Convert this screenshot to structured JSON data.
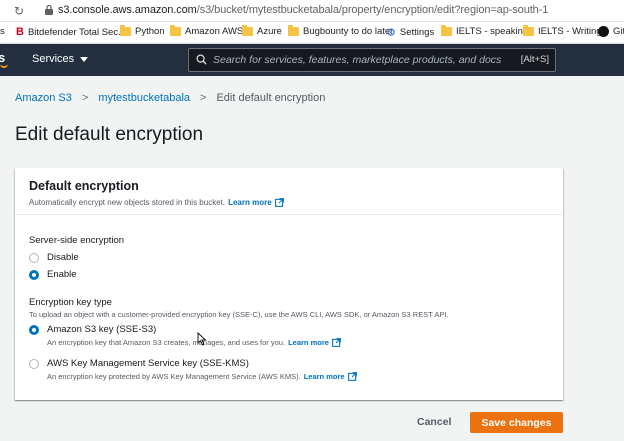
{
  "browser": {
    "url_host": "s3.console.aws.amazon.com",
    "url_path": "/s3/bucket/mytestbucketabala/property/encryption/edit?region=ap-south-1",
    "bookmarks": [
      {
        "label": "s",
        "icon": "none"
      },
      {
        "label": "Bitdefender Total Sec...",
        "icon": "bitdefender-icon"
      },
      {
        "label": "Python",
        "icon": "folder-icon"
      },
      {
        "label": "Amazon AWS",
        "icon": "folder-icon"
      },
      {
        "label": "Azure",
        "icon": "folder-icon"
      },
      {
        "label": "Bugbounty to do later",
        "icon": "folder-icon"
      },
      {
        "label": "Settings",
        "icon": "gear-icon"
      },
      {
        "label": "IELTS - speaking",
        "icon": "folder-icon"
      },
      {
        "label": "IELTS - Writing",
        "icon": "folder-icon"
      },
      {
        "label": "Git",
        "icon": "github-icon"
      }
    ]
  },
  "awsnav": {
    "logo": "s",
    "services_label": "Services",
    "search_placeholder": "Search for services, features, marketplace products, and docs",
    "search_shortcut": "[Alt+S]"
  },
  "breadcrumb": {
    "items": [
      "Amazon S3",
      "mytestbucketabala",
      "Edit default encryption"
    ]
  },
  "page_title": "Edit default encryption",
  "card": {
    "title": "Default encryption",
    "description": "Automatically encrypt new objects stored in this bucket.",
    "learn_more": "Learn more",
    "sse_label": "Server-side encryption",
    "sse_options": [
      {
        "label": "Disable",
        "selected": false
      },
      {
        "label": "Enable",
        "selected": true
      }
    ],
    "key_type_label": "Encryption key type",
    "key_type_hint": "To upload an object with a customer-provided encryption key (SSE-C), use the AWS CLI, AWS SDK, or Amazon S3 REST API.",
    "key_options": [
      {
        "label": "Amazon S3 key (SSE-S3)",
        "desc": "An encryption key that Amazon S3 creates, manages, and uses for you.",
        "learn_more": "Learn more",
        "selected": true
      },
      {
        "label": "AWS Key Management Service key (SSE-KMS)",
        "desc": "An encryption key protected by AWS Key Management Service (AWS KMS).",
        "learn_more": "Learn more",
        "selected": false
      }
    ]
  },
  "actions": {
    "cancel": "Cancel",
    "save": "Save changes"
  },
  "colors": {
    "nav_bg": "#232f3e",
    "link": "#0073bb",
    "primary_button": "#ec7211"
  }
}
